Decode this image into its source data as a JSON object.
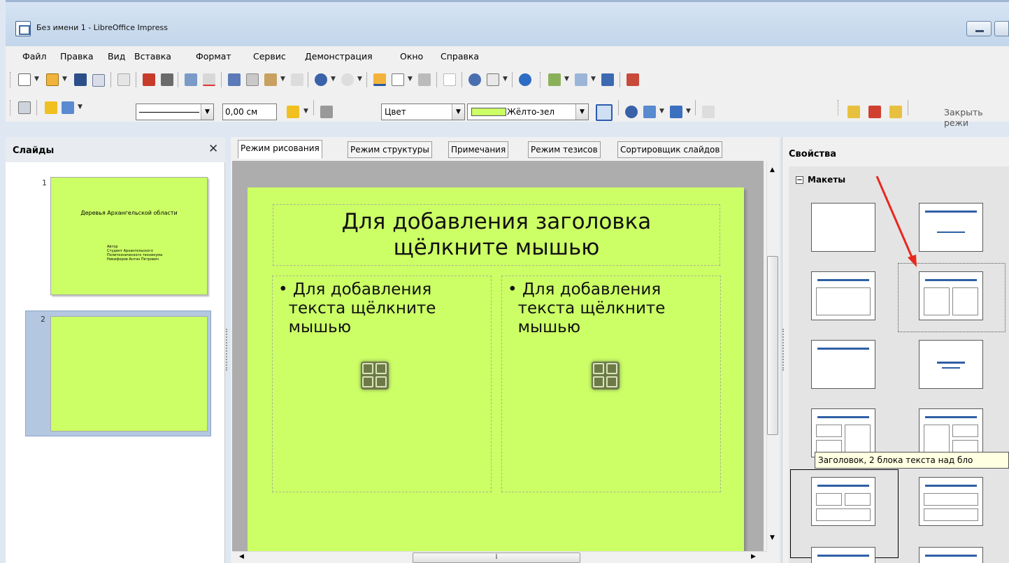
{
  "window": {
    "title": "Без имени 1 - LibreOffice Impress"
  },
  "menu": [
    "Файл",
    "Правка",
    "Вид",
    "Вставка",
    "Формат",
    "Сервис",
    "Демонстрация",
    "Окно",
    "Справка"
  ],
  "toolbar2": {
    "line_width": "0,00 см",
    "fill_type": "Цвет",
    "fill_color": "Жёлто-зел",
    "close_master": "Закрыть режи"
  },
  "slides_panel": {
    "title": "Слайды",
    "slides": [
      {
        "number": "1",
        "title": "Деревья Архангельской области",
        "subtitle": "Автор\nСтудент Архангельского\nПолитехнического техникума\nНикифоров Антон Петрович"
      },
      {
        "number": "2"
      }
    ]
  },
  "tabs": [
    "Режим рисования",
    "Режим структуры",
    "Примечания",
    "Режим тезисов",
    "Сортировщик слайдов"
  ],
  "slide": {
    "title": "Для добавления заголовка\nщёлкните мышью",
    "left_text": "• Для добавления\n  текста щёлкните\n  мышью",
    "right_text": "• Для добавления\n  текста щёлкните\n  мышью"
  },
  "sidebar": {
    "title": "Свойства",
    "section": "Макеты",
    "tooltip": "Заголовок, 2 блока текста над бло"
  },
  "colors": {
    "slide_bg": "#ccff66",
    "accent": "#2f5fa5"
  }
}
